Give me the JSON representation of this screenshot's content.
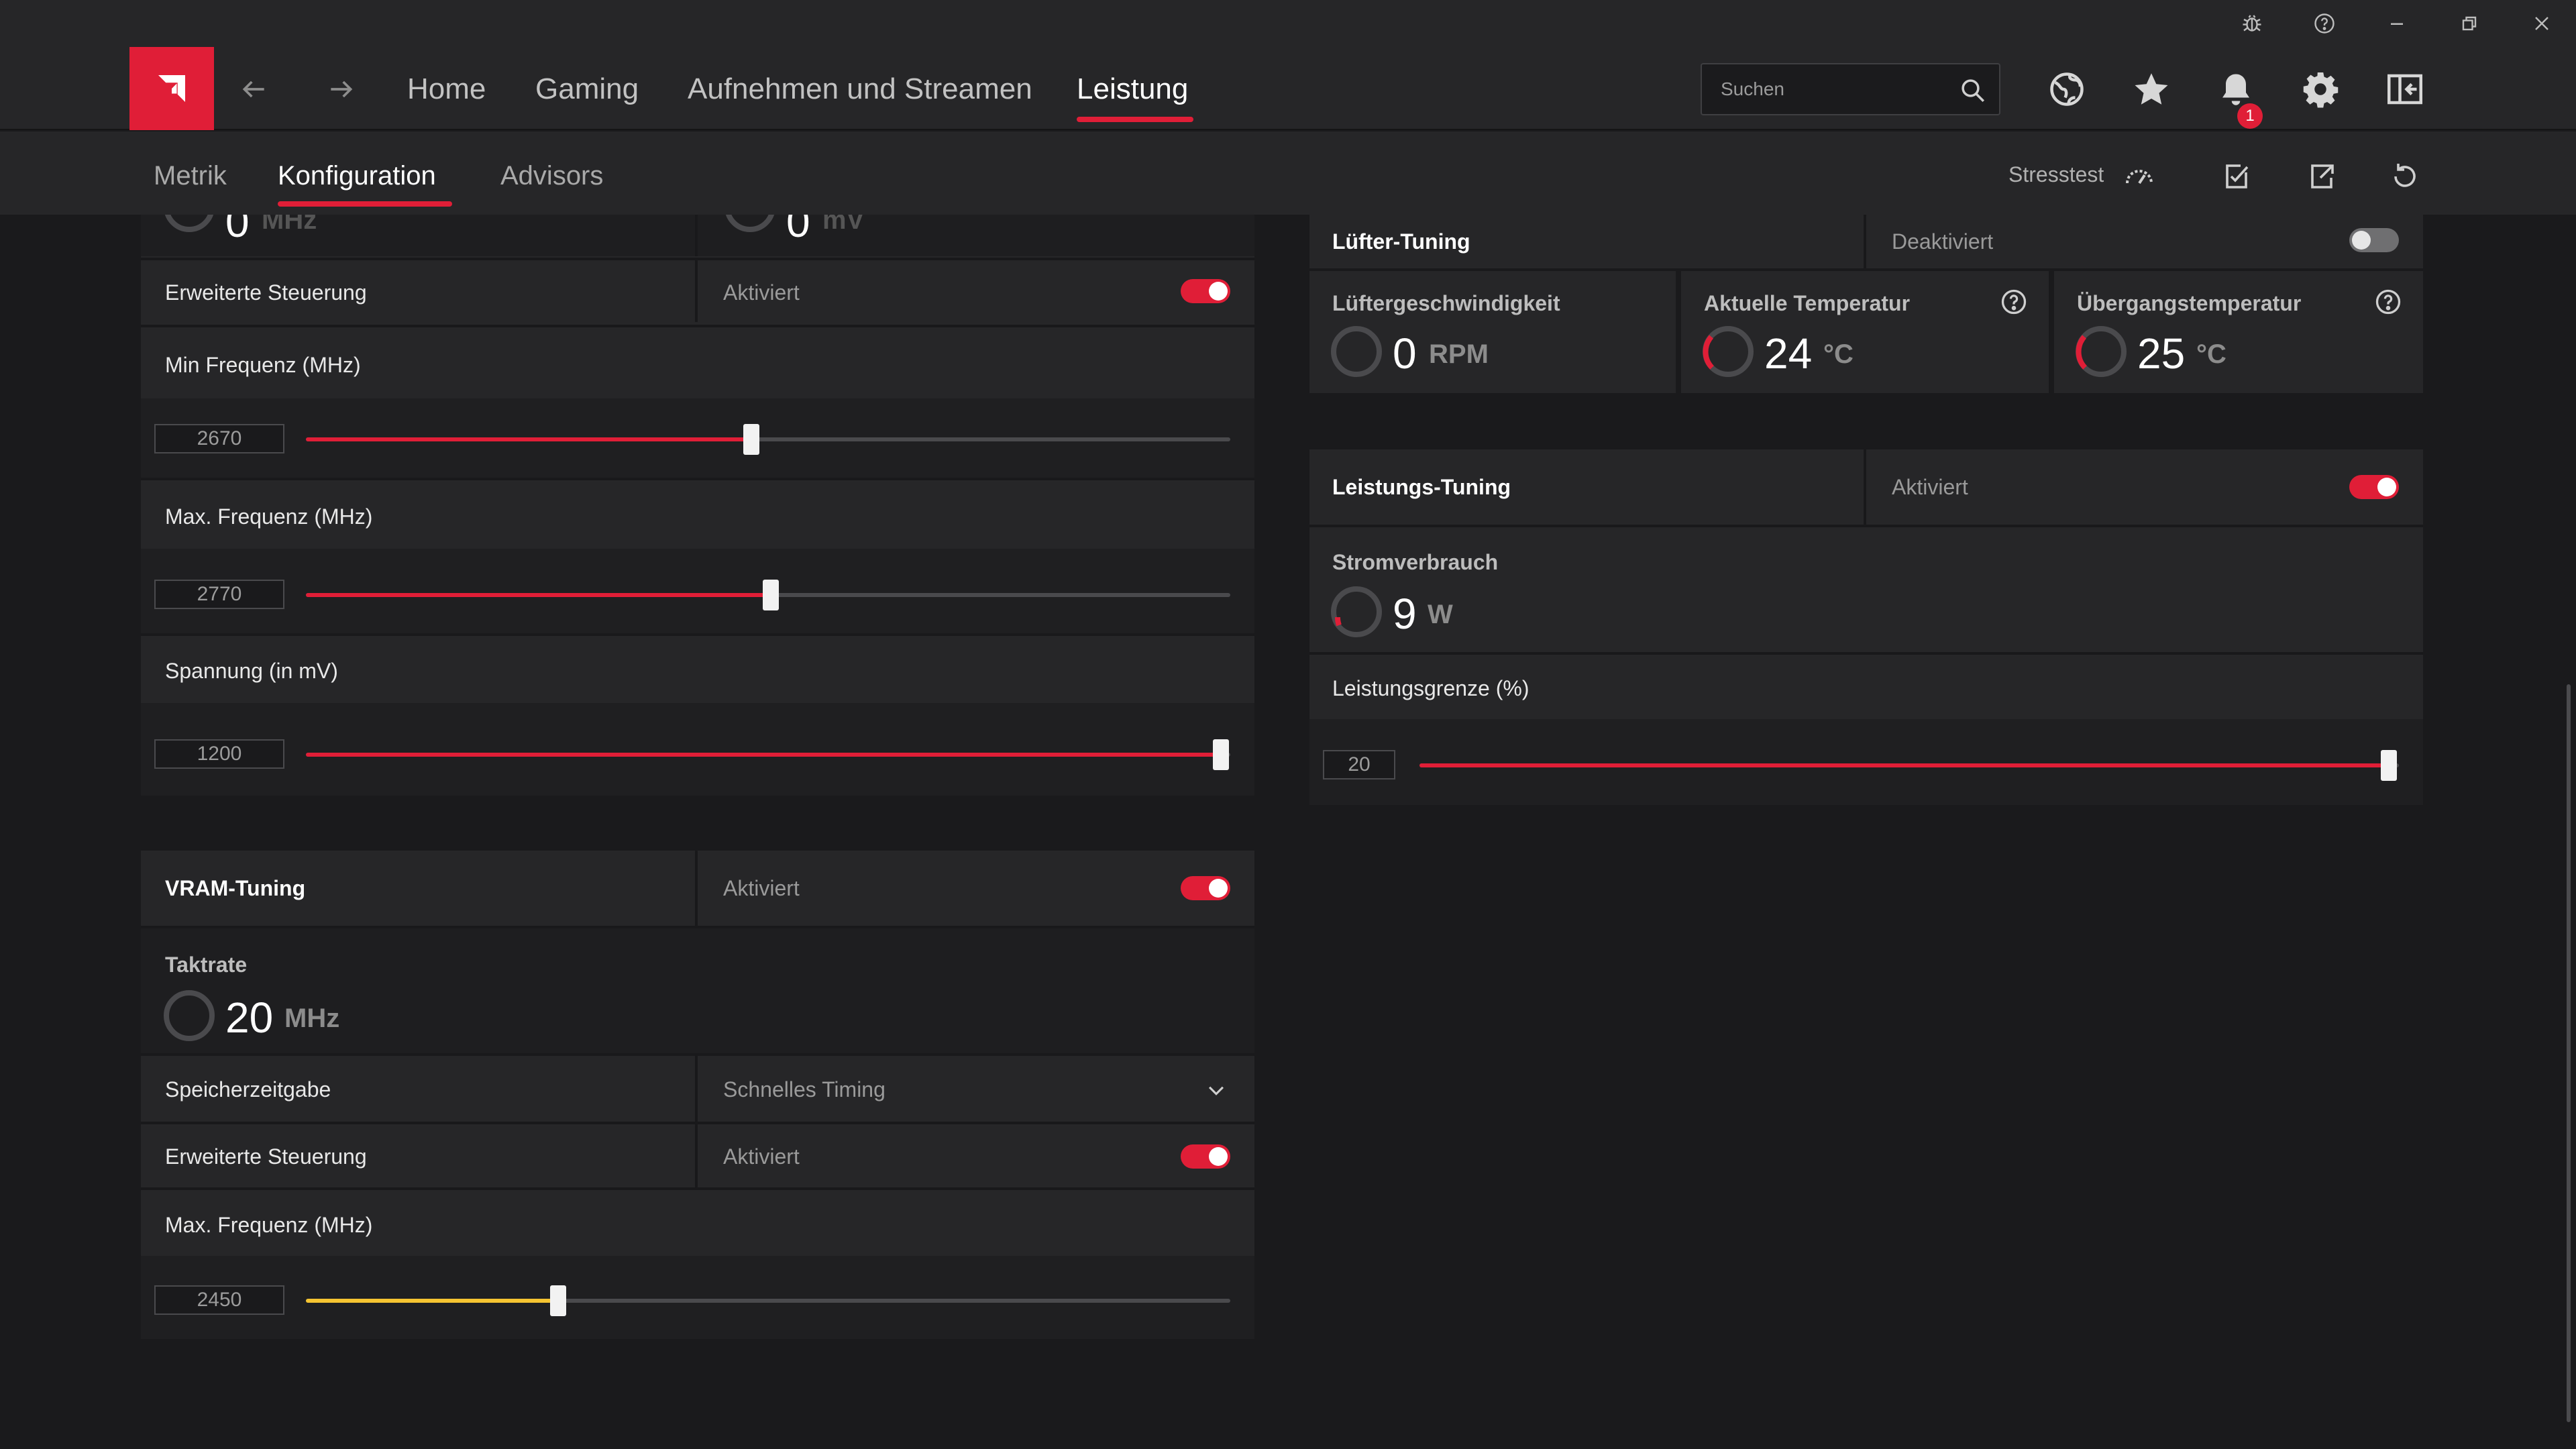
{
  "colors": {
    "accent": "#e01e37",
    "vram_accent": "#f5c431",
    "background": "#1a1a1c",
    "panel": "#262628"
  },
  "nav": {
    "items": [
      "Home",
      "Gaming",
      "Aufnehmen und Streamen",
      "Leistung"
    ],
    "active": "Leistung"
  },
  "search": {
    "placeholder": "Suchen"
  },
  "notifications": {
    "count": "1"
  },
  "subnav": {
    "tabs": [
      "Metrik",
      "Konfiguration",
      "Advisors"
    ],
    "active": "Konfiguration",
    "stresstest_label": "Stresstest"
  },
  "gpu_tuning": {
    "partial_top": {
      "value1": "0",
      "unit1": "MHz",
      "value2": "0",
      "unit2": "mV"
    },
    "advanced_control": {
      "label": "Erweiterte Steuerung",
      "state": "Aktiviert",
      "enabled": true
    },
    "min_freq": {
      "label": "Min Frequenz (MHz)",
      "value": "2670",
      "fraction": 0.482
    },
    "max_freq": {
      "label": "Max. Frequenz (MHz)",
      "value": "2770",
      "fraction": 0.503
    },
    "voltage": {
      "label": "Spannung (in mV)",
      "value": "1200",
      "fraction": 0.99
    }
  },
  "vram_tuning": {
    "title": "VRAM-Tuning",
    "state": "Aktiviert",
    "enabled": true,
    "clock": {
      "label": "Taktrate",
      "value": "20",
      "unit": "MHz"
    },
    "memory_timing": {
      "label": "Speicherzeitgabe",
      "value": "Schnelles Timing"
    },
    "advanced_control": {
      "label": "Erweiterte Steuerung",
      "state": "Aktiviert",
      "enabled": true
    },
    "max_freq": {
      "label": "Max. Frequenz (MHz)",
      "value": "2450",
      "fraction": 0.273
    }
  },
  "fan_tuning": {
    "title": "Lüfter-Tuning",
    "state": "Deaktiviert",
    "enabled": false,
    "fan_speed": {
      "label": "Lüftergeschwindigkeit",
      "value": "0",
      "unit": "RPM"
    },
    "current_temp": {
      "label": "Aktuelle Temperatur",
      "value": "24",
      "unit": "°C"
    },
    "junction_temp": {
      "label": "Übergangstemperatur",
      "value": "25",
      "unit": "°C"
    }
  },
  "power_tuning": {
    "title": "Leistungs-Tuning",
    "state": "Aktiviert",
    "enabled": true,
    "power_draw": {
      "label": "Stromverbrauch",
      "value": "9",
      "unit": "W"
    },
    "power_limit": {
      "label": "Leistungsgrenze (%)",
      "value": "20",
      "fraction": 0.99
    }
  }
}
